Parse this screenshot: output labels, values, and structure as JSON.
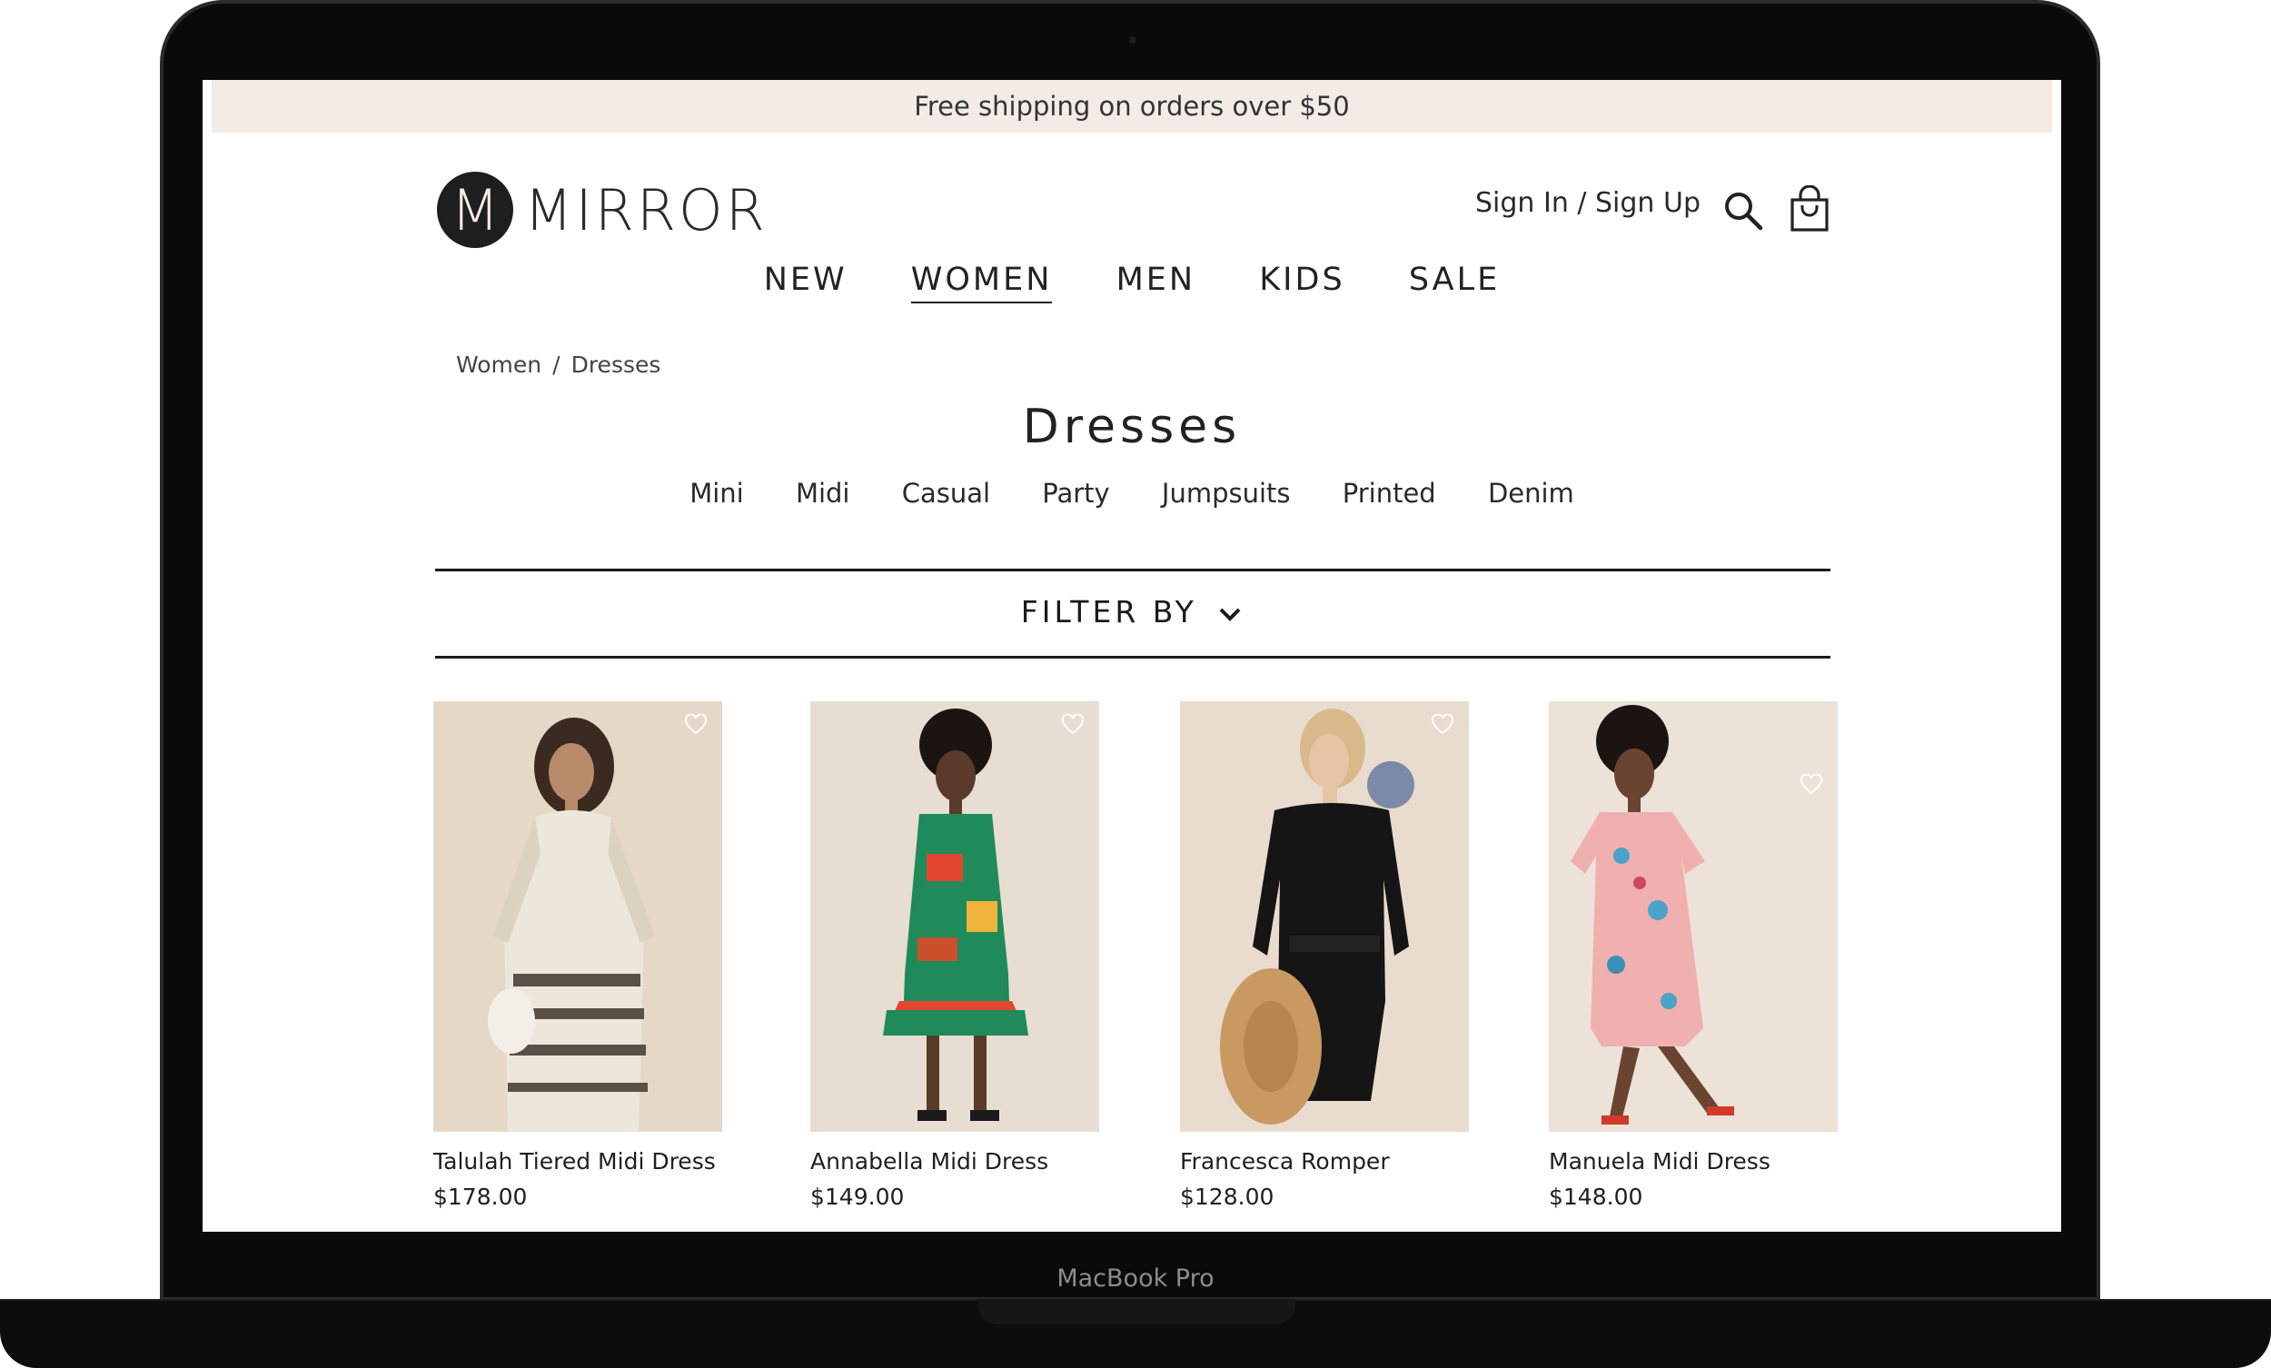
{
  "promo": {
    "text": "Free shipping on orders over $50"
  },
  "brand": {
    "monogram": "M",
    "name": "MIRROR"
  },
  "header": {
    "account_label": "Sign In / Sign Up"
  },
  "nav": {
    "items": [
      "NEW",
      "WOMEN",
      "MEN",
      "KIDS",
      "SALE"
    ],
    "active": "WOMEN"
  },
  "breadcrumb": {
    "items": [
      "Women",
      "Dresses"
    ],
    "separator": "/"
  },
  "page": {
    "title": "Dresses"
  },
  "subcategories": [
    "Mini",
    "Midi",
    "Casual",
    "Party",
    "Jumpsuits",
    "Printed",
    "Denim"
  ],
  "filter": {
    "label": "FILTER BY"
  },
  "products": [
    {
      "name": "Talulah Tiered Midi Dress",
      "price": "$178.00"
    },
    {
      "name": "Annabella Midi Dress",
      "price": "$149.00"
    },
    {
      "name": "Francesca Romper",
      "price": "$128.00"
    },
    {
      "name": "Manuela Midi Dress",
      "price": "$148.00"
    }
  ],
  "device": {
    "label": "MacBook Pro"
  },
  "icons": [
    "search-icon",
    "shopping-bag-icon",
    "chevron-down-icon",
    "heart-icon"
  ],
  "colors": {
    "promo_bg": "#f2ebe6",
    "text": "#1c1c1c",
    "logo_mark": "#1e1e1e",
    "product_bg": "#ece1d6"
  }
}
